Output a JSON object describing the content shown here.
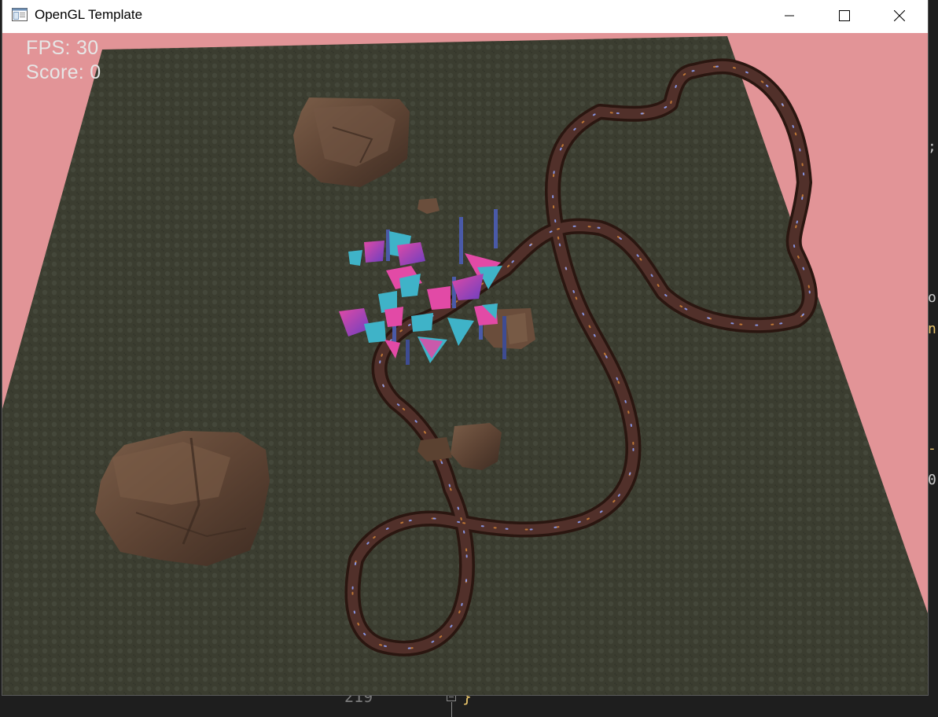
{
  "window": {
    "title": "OpenGL Template"
  },
  "hud": {
    "fps_label": "FPS: 30",
    "score_label": "Score: 0"
  },
  "ide": {
    "line_number": "219",
    "brace": "}",
    "right_glyphs": [
      ";",
      "o",
      "n",
      "-",
      "0"
    ]
  },
  "colors": {
    "sky": "#e29497",
    "ground": "#3b3d30",
    "track": "#4a2c22",
    "rock": "#6a4e3c",
    "crystal_pink": "#d0459a",
    "crystal_teal": "#3fb3c8",
    "pillar_blue": "#4a5aa8"
  },
  "icons": {
    "minimize": "minimize-icon",
    "maximize": "maximize-icon",
    "close": "close-icon",
    "app": "window-app-icon"
  }
}
